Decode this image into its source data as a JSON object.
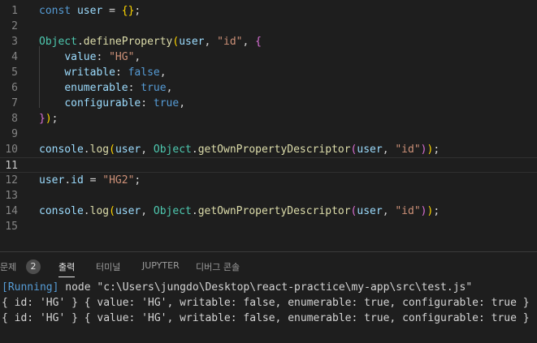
{
  "editor": {
    "lines": [
      {
        "n": "1",
        "segs": [
          [
            "kw",
            "const "
          ],
          [
            "var",
            "user"
          ],
          [
            "p",
            " = "
          ],
          [
            "b1",
            "{}"
          ],
          [
            "p",
            ";"
          ]
        ]
      },
      {
        "n": "2",
        "segs": []
      },
      {
        "n": "3",
        "segs": [
          [
            "cls",
            "Object"
          ],
          [
            "p",
            "."
          ],
          [
            "fn",
            "defineProperty"
          ],
          [
            "b1",
            "("
          ],
          [
            "var",
            "user"
          ],
          [
            "p",
            ", "
          ],
          [
            "str",
            "\"id\""
          ],
          [
            "p",
            ", "
          ],
          [
            "b2",
            "{"
          ]
        ]
      },
      {
        "n": "4",
        "segs": [
          [
            "p",
            "    "
          ],
          [
            "var",
            "value"
          ],
          [
            "p",
            ": "
          ],
          [
            "str",
            "\"HG\""
          ],
          [
            "p",
            ","
          ]
        ]
      },
      {
        "n": "5",
        "segs": [
          [
            "p",
            "    "
          ],
          [
            "var",
            "writable"
          ],
          [
            "p",
            ": "
          ],
          [
            "kw",
            "false"
          ],
          [
            "p",
            ","
          ]
        ]
      },
      {
        "n": "6",
        "segs": [
          [
            "p",
            "    "
          ],
          [
            "var",
            "enumerable"
          ],
          [
            "p",
            ": "
          ],
          [
            "kw",
            "true"
          ],
          [
            "p",
            ","
          ]
        ]
      },
      {
        "n": "7",
        "segs": [
          [
            "p",
            "    "
          ],
          [
            "var",
            "configurable"
          ],
          [
            "p",
            ": "
          ],
          [
            "kw",
            "true"
          ],
          [
            "p",
            ","
          ]
        ]
      },
      {
        "n": "8",
        "segs": [
          [
            "b2",
            "}"
          ],
          [
            "b1",
            ")"
          ],
          [
            "p",
            ";"
          ]
        ]
      },
      {
        "n": "9",
        "segs": []
      },
      {
        "n": "10",
        "segs": [
          [
            "var",
            "console"
          ],
          [
            "p",
            "."
          ],
          [
            "fn",
            "log"
          ],
          [
            "b1",
            "("
          ],
          [
            "var",
            "user"
          ],
          [
            "p",
            ", "
          ],
          [
            "cls",
            "Object"
          ],
          [
            "p",
            "."
          ],
          [
            "fn",
            "getOwnPropertyDescriptor"
          ],
          [
            "b2",
            "("
          ],
          [
            "var",
            "user"
          ],
          [
            "p",
            ", "
          ],
          [
            "str",
            "\"id\""
          ],
          [
            "b2",
            ")"
          ],
          [
            "b1",
            ")"
          ],
          [
            "p",
            ";"
          ]
        ]
      },
      {
        "n": "11",
        "segs": []
      },
      {
        "n": "12",
        "segs": [
          [
            "var",
            "user"
          ],
          [
            "p",
            "."
          ],
          [
            "var",
            "id"
          ],
          [
            "p",
            " = "
          ],
          [
            "str",
            "\"HG2\""
          ],
          [
            "p",
            ";"
          ]
        ]
      },
      {
        "n": "13",
        "segs": []
      },
      {
        "n": "14",
        "segs": [
          [
            "var",
            "console"
          ],
          [
            "p",
            "."
          ],
          [
            "fn",
            "log"
          ],
          [
            "b1",
            "("
          ],
          [
            "var",
            "user"
          ],
          [
            "p",
            ", "
          ],
          [
            "cls",
            "Object"
          ],
          [
            "p",
            "."
          ],
          [
            "fn",
            "getOwnPropertyDescriptor"
          ],
          [
            "b2",
            "("
          ],
          [
            "var",
            "user"
          ],
          [
            "p",
            ", "
          ],
          [
            "str",
            "\"id\""
          ],
          [
            "b2",
            ")"
          ],
          [
            "b1",
            ")"
          ],
          [
            "p",
            ";"
          ]
        ]
      },
      {
        "n": "15",
        "segs": []
      }
    ],
    "active_line": "11"
  },
  "panel": {
    "tabs": {
      "problems": "문제",
      "problems_count": "2",
      "output": "출력",
      "terminal": "터미널",
      "jupyter": "JUPYTER",
      "debug_console": "디버그 콘솔"
    },
    "output": {
      "running_tag": "[Running]",
      "running_cmd": " node \"c:\\Users\\jungdo\\Desktop\\react-practice\\my-app\\src\\test.js\"",
      "result1": "{ id: 'HG' } { value: 'HG', writable: false, enumerable: true, configurable: true }",
      "result2": "{ id: 'HG' } { value: 'HG', writable: false, enumerable: true, configurable: true }"
    }
  }
}
